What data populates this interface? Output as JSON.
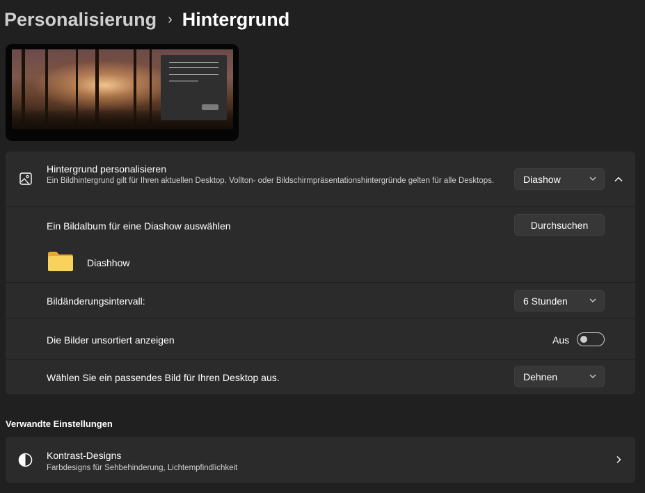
{
  "breadcrumb": {
    "parent": "Personalisierung",
    "current": "Hintergrund"
  },
  "personalize": {
    "title": "Hintergrund personalisieren",
    "description": "Ein Bildhintergrund gilt für Ihren aktuellen Desktop. Vollton- oder Bildschirmpräsentationshintergründe gelten für alle Desktops.",
    "dropdown_value": "Diashow",
    "icon": "image-icon",
    "collapse_icon": "chevron-up-icon"
  },
  "album": {
    "label": "Ein Bildalbum für eine Diashow auswählen",
    "button_label": "Durchsuchen",
    "folder_name": "Diashhow",
    "folder_icon": "folder-icon"
  },
  "interval": {
    "label": "Bildänderungsintervall:",
    "value": "6 Stunden"
  },
  "shuffle": {
    "label": "Die Bilder unsortiert anzeigen",
    "state_label": "Aus",
    "on": false
  },
  "fit": {
    "label": "Wählen Sie ein passendes Bild für Ihren Desktop aus.",
    "value": "Dehnen"
  },
  "related": {
    "heading": "Verwandte Einstellungen",
    "items": [
      {
        "title": "Kontrast-Designs",
        "subtitle": "Farbdesigns für Sehbehinderung, Lichtempfindlichkeit",
        "icon": "contrast-icon"
      }
    ]
  },
  "colors": {
    "background": "#202020",
    "card": "#2b2b2b",
    "control": "#373737"
  }
}
